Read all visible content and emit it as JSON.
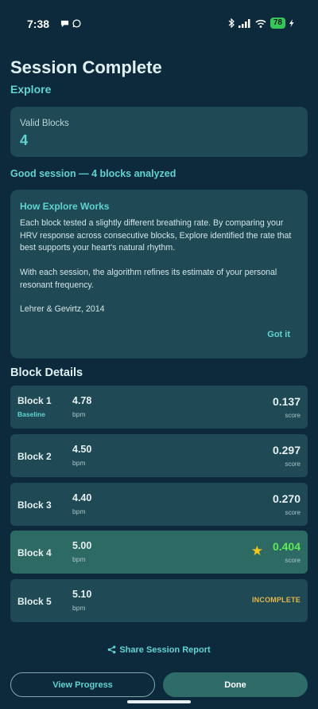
{
  "status_bar": {
    "time": "7:38",
    "battery": "78",
    "left_icons": [
      "chat-icon",
      "whatsapp-icon"
    ],
    "right_icons": [
      "bluetooth-icon",
      "signal-icon",
      "wifi-icon",
      "battery-icon"
    ]
  },
  "header": {
    "title": "Session Complete",
    "subtitle": "Explore"
  },
  "valid_blocks": {
    "label": "Valid Blocks",
    "value": "4"
  },
  "session_summary": "Good session — 4 blocks analyzed",
  "info_card": {
    "title": "How Explore Works",
    "paragraph1": "Each block tested a slightly different breathing rate. By comparing your HRV response across consecutive blocks, Explore identified the rate that best supports your heart's natural rhythm.",
    "paragraph2": "With each session, the algorithm refines its estimate of your personal resonant frequency.",
    "citation": "Lehrer & Gevirtz, 2014",
    "dismiss_label": "Got it"
  },
  "block_details": {
    "title": "Block Details",
    "blocks": [
      {
        "name": "Block 1",
        "tag": "Baseline",
        "bpm": "4.78",
        "bpm_unit": "bpm",
        "score": "0.137",
        "score_unit": "score"
      },
      {
        "name": "Block 2",
        "bpm": "4.50",
        "bpm_unit": "bpm",
        "score": "0.297",
        "score_unit": "score"
      },
      {
        "name": "Block 3",
        "bpm": "4.40",
        "bpm_unit": "bpm",
        "score": "0.270",
        "score_unit": "score"
      },
      {
        "name": "Block 4",
        "bpm": "5.00",
        "bpm_unit": "bpm",
        "score": "0.404",
        "score_unit": "score",
        "best": true
      },
      {
        "name": "Block 5",
        "bpm": "5.10",
        "bpm_unit": "bpm",
        "status": "INCOMPLETE"
      }
    ]
  },
  "share_label": "Share Session Report",
  "buttons": {
    "progress": "View Progress",
    "done": "Done"
  },
  "colors": {
    "background": "#0d2a3c",
    "card": "#1f4a55",
    "accent": "#5fd4d0",
    "best_row": "#2e6a64",
    "best_score": "#5ee856",
    "star": "#f5c518",
    "incomplete": "#e6b54a"
  }
}
